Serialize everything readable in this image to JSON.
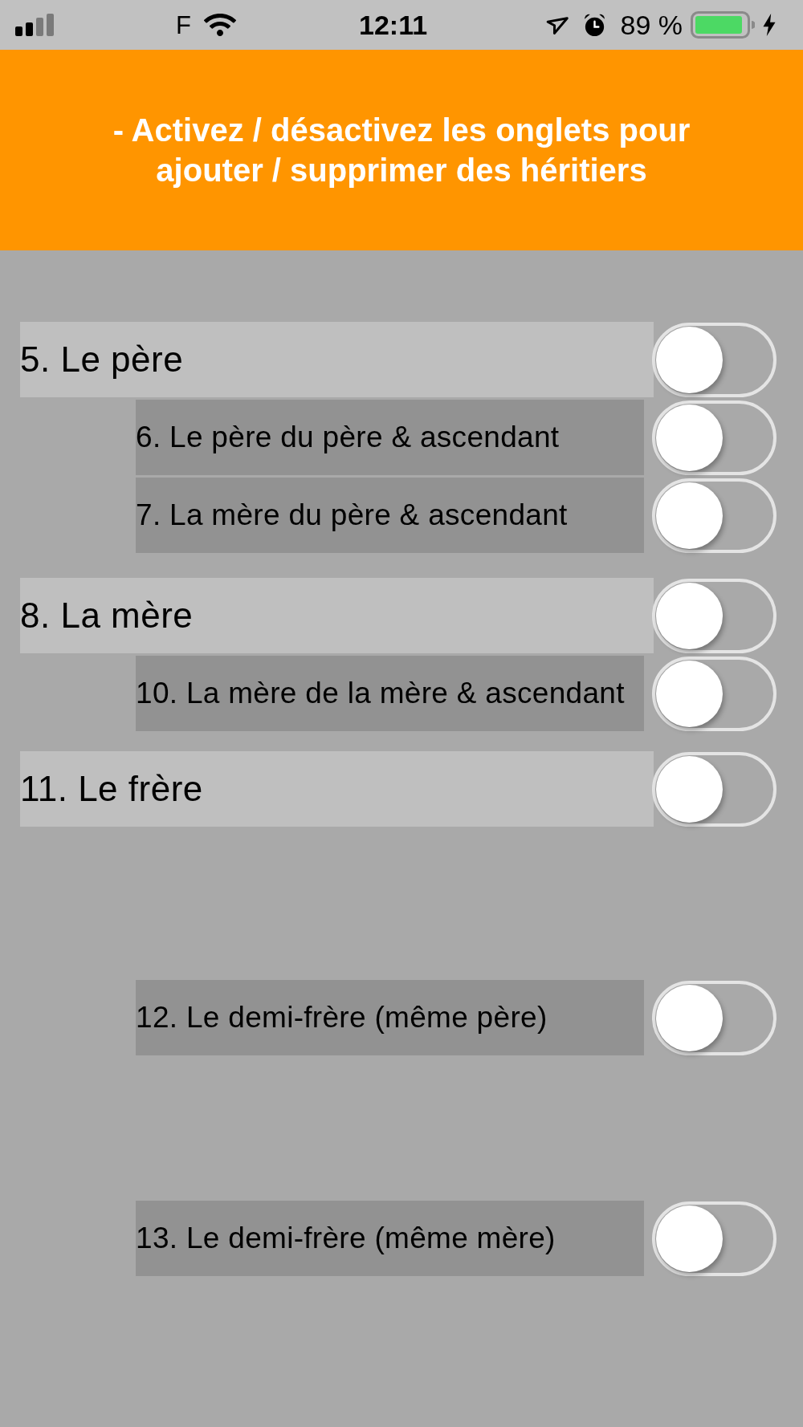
{
  "status_bar": {
    "carrier": "F",
    "time": "12:11",
    "battery": "89 %"
  },
  "header": {
    "text": "- Activez / désactivez les onglets pour ajouter / supprimer des héritiers"
  },
  "heirs": [
    {
      "label": "5. Le père",
      "on": false,
      "children": [
        {
          "label": "6. Le père du père & ascendant",
          "on": false
        },
        {
          "label": "7. La mère du père & ascendant",
          "on": false
        }
      ]
    },
    {
      "label": "8. La mère",
      "on": false,
      "children": [
        {
          "label": "10. La mère de la mère & ascendant",
          "on": false
        }
      ]
    },
    {
      "label": "11. Le frère",
      "on": false,
      "children": [
        {
          "label": "12. Le demi-frère (même père)",
          "on": false
        },
        {
          "label": "13. Le demi-frère (même mère)",
          "on": false
        }
      ]
    }
  ]
}
